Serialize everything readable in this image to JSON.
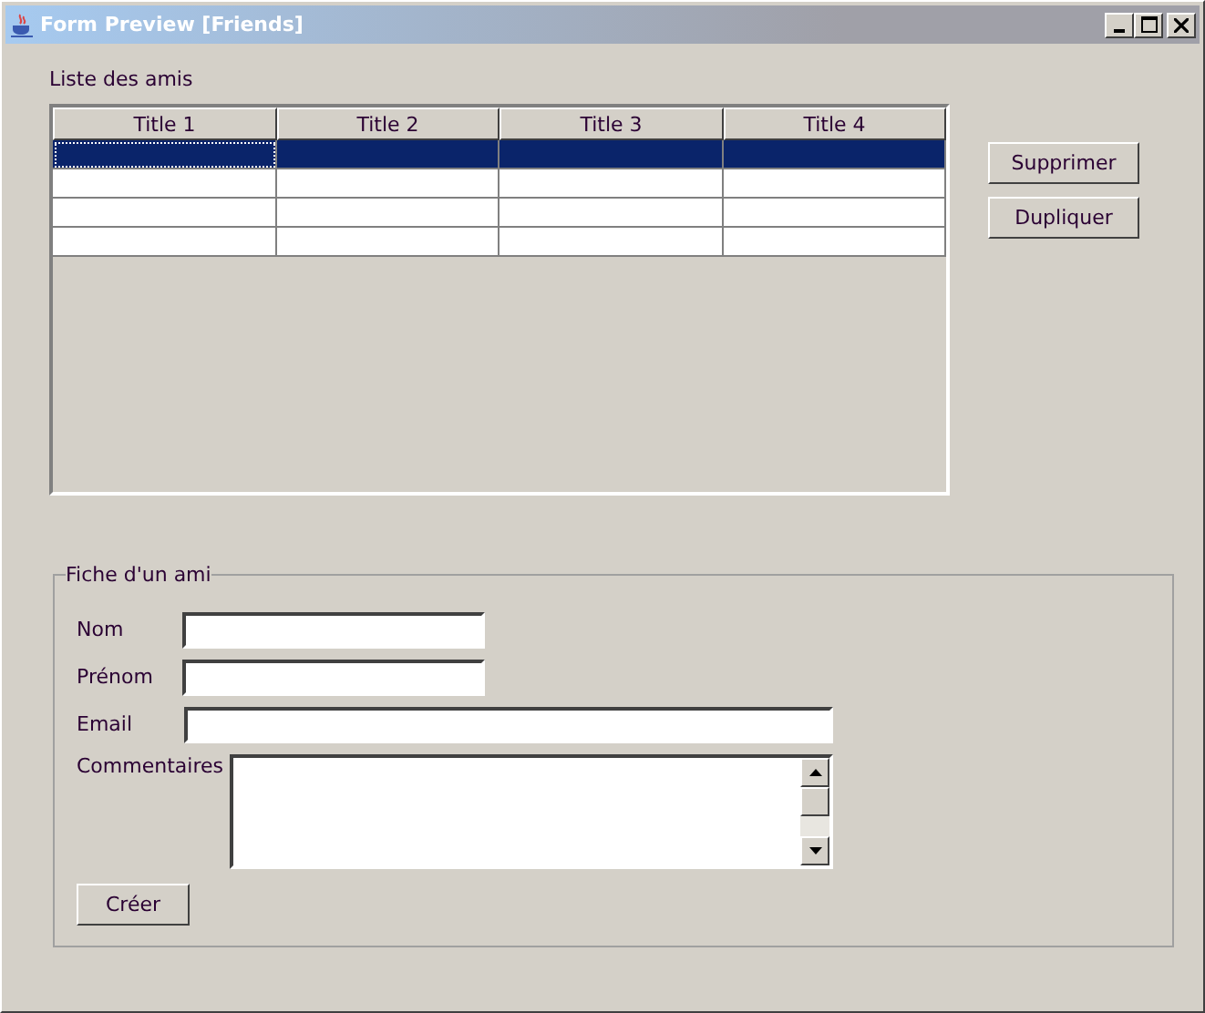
{
  "window": {
    "title": "Form Preview [Friends]"
  },
  "list_label": "Liste des amis",
  "table": {
    "columns": [
      "Title 1",
      "Title 2",
      "Title 3",
      "Title 4"
    ],
    "rows": [
      {
        "selected": true
      },
      {
        "selected": false
      },
      {
        "selected": false
      },
      {
        "selected": false
      }
    ]
  },
  "side_buttons": [
    "Supprimer",
    "Dupliquer"
  ],
  "form": {
    "legend": "Fiche d'un ami",
    "fields": [
      {
        "label": "Nom",
        "kind": "short"
      },
      {
        "label": "Prénom",
        "kind": "short"
      },
      {
        "label": "Email",
        "kind": "long"
      },
      {
        "label": "Commentaires",
        "kind": "textarea"
      }
    ],
    "button": "Créer"
  }
}
